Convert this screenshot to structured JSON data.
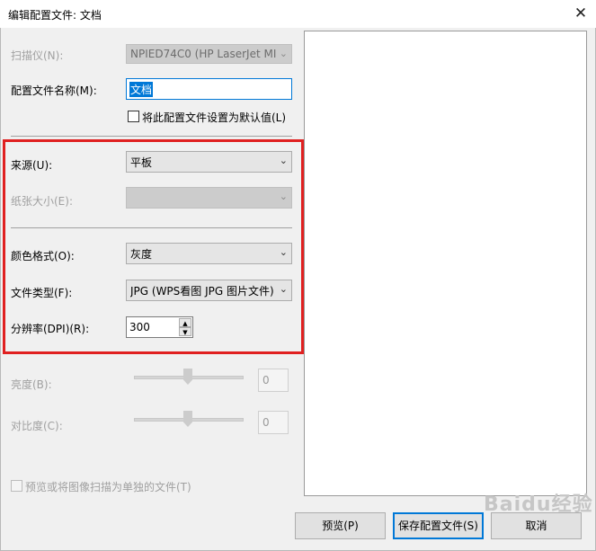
{
  "window": {
    "title": "编辑配置文件: 文档",
    "close_glyph": "✕"
  },
  "scanner": {
    "label": "扫描仪(N):",
    "value": "NPIED74C0 (HP LaserJet MI"
  },
  "profile_name": {
    "label": "配置文件名称(M):",
    "value": "文档"
  },
  "set_default": {
    "label": "将此配置文件设置为默认值(L)",
    "checked": false
  },
  "source": {
    "label": "来源(U):",
    "value": "平板"
  },
  "paper_size": {
    "label": "纸张大小(E):",
    "value": ""
  },
  "color_format": {
    "label": "颜色格式(O):",
    "value": "灰度"
  },
  "file_type": {
    "label": "文件类型(F):",
    "value": "JPG (WPS看图 JPG 图片文件)"
  },
  "resolution": {
    "label": "分辨率(DPI)(R):",
    "value": "300"
  },
  "brightness": {
    "label": "亮度(B):",
    "value": "0"
  },
  "contrast": {
    "label": "对比度(C):",
    "value": "0"
  },
  "separate_files": {
    "label": "预览或将图像扫描为单独的文件(T)",
    "checked": false
  },
  "buttons": {
    "preview": "预览(P)",
    "save": "保存配置文件(S)",
    "cancel": "取消"
  },
  "watermark": "Baidu经验",
  "colors": {
    "highlight": "#e02020",
    "accent": "#0078d7"
  }
}
